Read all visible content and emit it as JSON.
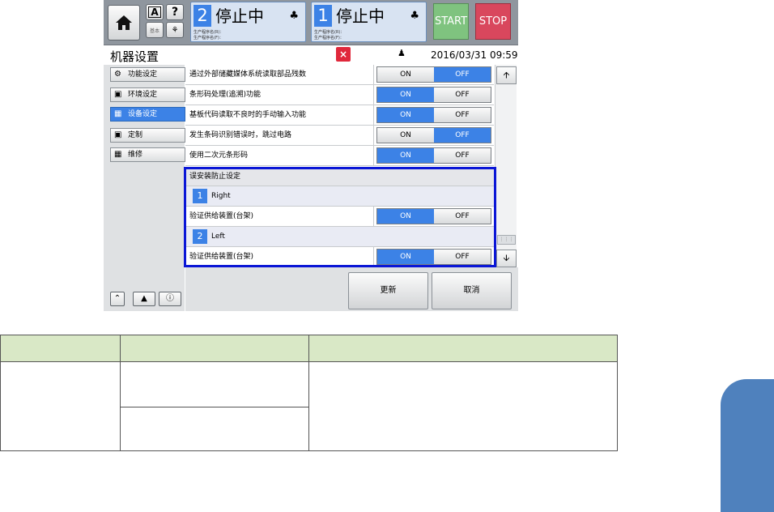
{
  "topbar": {
    "btn_a": "A",
    "btn_help": "?",
    "btn_mode": "基本",
    "lanes": [
      {
        "num": "2",
        "status": "停止中",
        "prog_r": "生产程序名(R)：",
        "prog_f": "生产程序名(F)："
      },
      {
        "num": "1",
        "status": "停止中",
        "prog_r": "生产程序名(R)：",
        "prog_f": "生产程序名(F)："
      }
    ],
    "start_label": "START",
    "stop_label": "STOP"
  },
  "titlebar": {
    "title": "机器设置",
    "close": "×",
    "datetime": "2016/03/31 09:59"
  },
  "nav": {
    "items": [
      {
        "label": "功能设定",
        "active": false
      },
      {
        "label": "环境设定",
        "active": false
      },
      {
        "label": "设备设定",
        "active": true
      },
      {
        "label": "定制",
        "active": false
      },
      {
        "label": "维修",
        "active": false
      }
    ]
  },
  "settings": {
    "rows": [
      {
        "label": "通过外部储藏媒体系统读取部品残数",
        "on": "ON",
        "off": "OFF",
        "selected": "OFF"
      },
      {
        "label": "条形码处理(追溯)功能",
        "on": "ON",
        "off": "OFF",
        "selected": "ON"
      },
      {
        "label": "基板代码读取不良时的手动输入功能",
        "on": "ON",
        "off": "OFF",
        "selected": "ON"
      },
      {
        "label": "发生条码识别错误时，跳过电路",
        "on": "ON",
        "off": "OFF",
        "selected": "OFF"
      },
      {
        "label": "使用二次元条形码",
        "on": "ON",
        "off": "OFF",
        "selected": "ON"
      }
    ],
    "group_title": "误安装防止设定",
    "sections": [
      {
        "num": "1",
        "name": "Right",
        "row_label": "验证供给装置(台架)",
        "on": "ON",
        "off": "OFF",
        "selected": "ON"
      },
      {
        "num": "2",
        "name": "Left",
        "row_label": "验证供给装置(台架)",
        "on": "ON",
        "off": "OFF",
        "selected": "ON"
      }
    ]
  },
  "actions": {
    "update": "更新",
    "cancel": "取消"
  },
  "colors": {
    "accent": "#3c82e6",
    "highlight": "#0a16d6",
    "start": "#7fc37f",
    "stop": "#d9475d",
    "table_header": "#d9e8c6",
    "side_tab": "#4f81bd"
  }
}
